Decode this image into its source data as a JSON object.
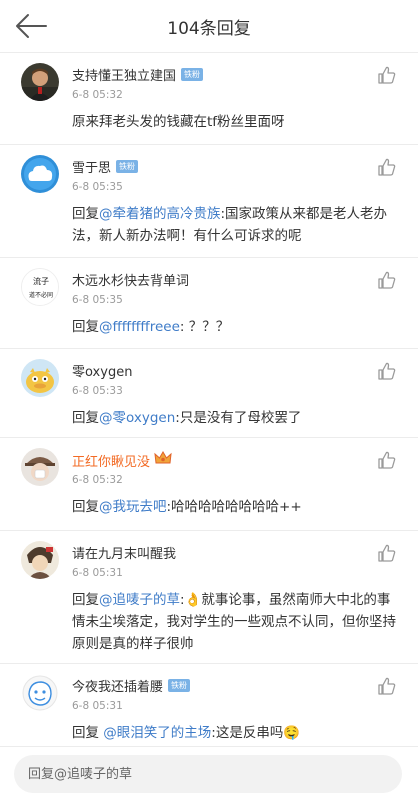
{
  "header": {
    "title": "104条回复"
  },
  "replies": [
    {
      "name": "支持懂王独立建国",
      "badge": "铁粉",
      "time": "6-8 05:32",
      "prefix": "",
      "mention": "",
      "text": "原来拜老头发的钱藏在tf粉丝里面呀"
    },
    {
      "name": "雪于思",
      "badge": "铁粉",
      "time": "6-8 05:35",
      "prefix": "回复",
      "mention": "@牵着猪的高冷贵族",
      "text": ":国家政策从来都是老人老办法，新人新办法啊！有什么可诉求的呢"
    },
    {
      "name": "木远水杉快去背单词",
      "badge": "",
      "time": "6-8 05:35",
      "prefix": "回复",
      "mention": "@ffffffffreee",
      "text": ": ？？？",
      "avatar_text_1": "流子",
      "avatar_text_2": "道不必同"
    },
    {
      "name": "零oxygen",
      "badge": "",
      "time": "6-8 05:33",
      "prefix": "回复",
      "mention": "@零oxygen",
      "text": ":只是没有了母校罢了"
    },
    {
      "name": "正红你瞅见没",
      "badge": "",
      "time": "6-8 05:32",
      "prefix": "回复",
      "mention": "@我玩去吧",
      "text": ":哈哈哈哈哈哈哈哈++"
    },
    {
      "name": "请在九月末叫醒我",
      "badge": "",
      "time": "6-8 05:31",
      "prefix": "回复",
      "mention": "@追唛子的草",
      "text": ":👌就事论事，虽然南师大中北的事情未尘埃落定，我对学生的一些观点不认同，但你坚持原则是真的样子很帅"
    },
    {
      "name": "今夜我还插着腰",
      "badge": "铁粉",
      "time": "6-8 05:31",
      "prefix": "回复 ",
      "mention": "@眼泪笑了的主场",
      "text": ":这是反串吗🤤"
    }
  ],
  "input": {
    "placeholder": "回复@追唛子的草"
  },
  "colors": {
    "mention": "#3f7cc8",
    "badge": "#7ab2e6",
    "highlight_name": "#f36b25"
  }
}
